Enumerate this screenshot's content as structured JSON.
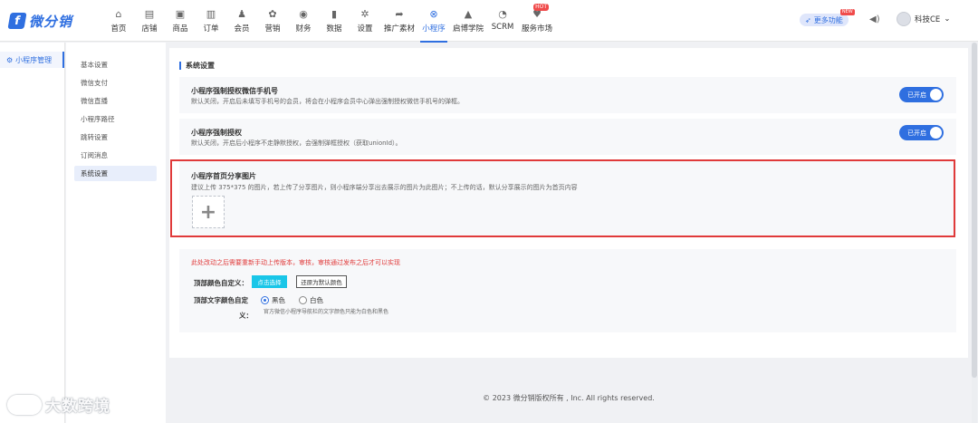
{
  "brand": {
    "logo_text": "微分销",
    "logo_glyph": "f",
    "accent": "#2f6fe0"
  },
  "nav": [
    {
      "label": "首页",
      "icon": "home-icon",
      "glyph": "⌂"
    },
    {
      "label": "店铺",
      "icon": "store-icon",
      "glyph": "▤"
    },
    {
      "label": "商品",
      "icon": "goods-icon",
      "glyph": "▣"
    },
    {
      "label": "订单",
      "icon": "order-icon",
      "glyph": "▥"
    },
    {
      "label": "会员",
      "icon": "member-icon",
      "glyph": "♟"
    },
    {
      "label": "营销",
      "icon": "marketing-icon",
      "glyph": "✿"
    },
    {
      "label": "财务",
      "icon": "finance-icon",
      "glyph": "◉"
    },
    {
      "label": "数据",
      "icon": "data-icon",
      "glyph": "▮"
    },
    {
      "label": "设置",
      "icon": "settings-icon",
      "glyph": "✲"
    },
    {
      "label": "推广素材",
      "icon": "share-icon",
      "glyph": "➦"
    },
    {
      "label": "小程序",
      "icon": "miniprogram-icon",
      "glyph": "⊗"
    },
    {
      "label": "启博学院",
      "icon": "academy-icon",
      "glyph": "▲"
    },
    {
      "label": "SCRM",
      "icon": "scrm-icon",
      "glyph": "◔"
    },
    {
      "label": "服务市场",
      "icon": "service-market-icon",
      "glyph": "♥"
    }
  ],
  "nav_hot_badge": "HOT",
  "header": {
    "more_label": "更多功能",
    "more_badge": "NEW",
    "username": "科技CE"
  },
  "sidebar": {
    "primary": "小程序管理"
  },
  "subnav": [
    "基本设置",
    "微信支付",
    "微信直播",
    "小程序路径",
    "跳转设置",
    "订阅消息",
    "系统设置"
  ],
  "section_title": "系统设置",
  "cards": [
    {
      "title": "小程序强制授权微信手机号",
      "desc": "默认关闭，开启后未填写手机号的会员，将会在小程序会员中心弹出强制授权微信手机号的弹框。",
      "toggle": "已开启"
    },
    {
      "title": "小程序强制授权",
      "desc": "默认关闭，开启后小程序不走静默授权，会强制弹框授权（获取unionId）。",
      "toggle": "已开启"
    }
  ],
  "share_image": {
    "title": "小程序首页分享图片",
    "desc": "建议上传 375*375 的图片，若上传了分享图片，则小程序端分享出去展示的图片为此图片；不上传的话，默认分享展示的图片为首页内容",
    "upload_glyph": "+"
  },
  "color_section": {
    "warning": "此处改动之后需要重新手动上传版本，审核，审核通过发布之后才可以实现",
    "top_color_label": "顶部颜色自定义：",
    "pick_button": "点击选择",
    "reset_button": "还原为默认颜色",
    "text_color_label_1": "顶部文字颜色自定",
    "text_color_label_2": "义：",
    "option_black": "黑色",
    "option_white": "白色",
    "selected": "黑色",
    "hint": "官方微信小程序导航栏的文字颜色只能为白色和黑色"
  },
  "footer": "© 2023 微分销版权所有 , Inc. All rights reserved.",
  "watermark": "大数跨境"
}
